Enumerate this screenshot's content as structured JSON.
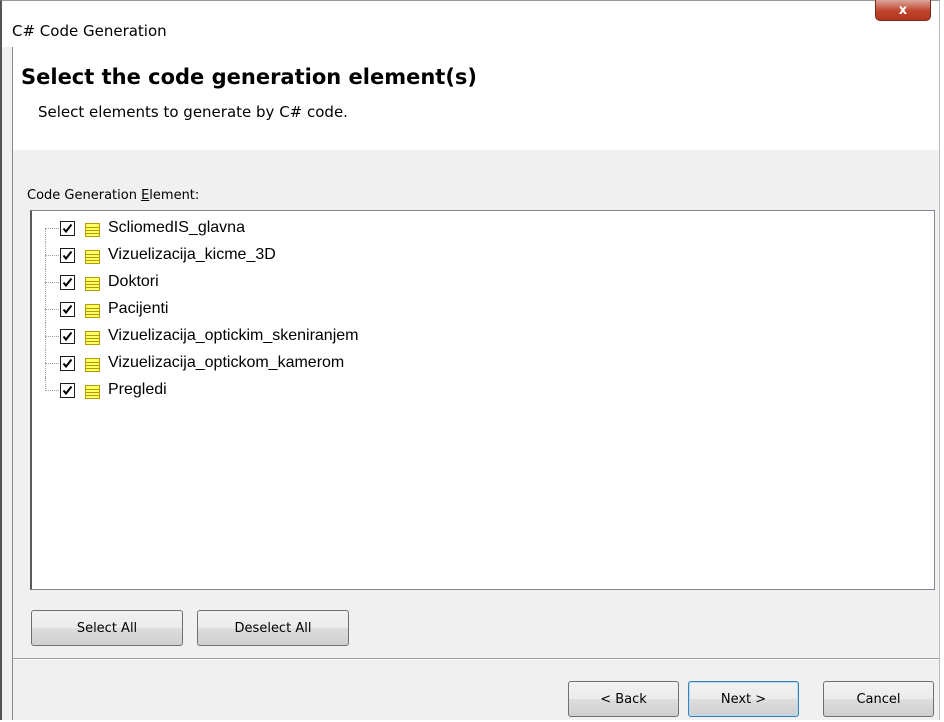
{
  "window": {
    "title": "C# Code Generation",
    "close_label": "x"
  },
  "header": {
    "heading": "Select the code generation element(s)",
    "subheading": "Select elements to generate by C# code."
  },
  "elements": {
    "label_prefix": "Code Generation ",
    "label_mnemonic": "E",
    "label_rest": "lement:",
    "items": [
      {
        "label": "ScliomedIS_glavna",
        "checked": true,
        "icon": "table-icon"
      },
      {
        "label": "Vizuelizacija_kicme_3D",
        "checked": true,
        "icon": "table-icon"
      },
      {
        "label": "Doktori",
        "checked": true,
        "icon": "table-icon"
      },
      {
        "label": "Pacijenti",
        "checked": true,
        "icon": "table-icon"
      },
      {
        "label": "Vizuelizacija_optickim_skeniranjem",
        "checked": true,
        "icon": "table-icon"
      },
      {
        "label": "Vizuelizacija_optickom_kamerom",
        "checked": true,
        "icon": "table-icon"
      },
      {
        "label": "Pregledi",
        "checked": true,
        "icon": "table-icon"
      }
    ]
  },
  "buttons": {
    "select_all": "Select All",
    "deselect_all": "Deselect All",
    "back": "< Back",
    "next": "Next >",
    "cancel": "Cancel"
  },
  "colors": {
    "icon_yellow": "#ffff66",
    "icon_border": "#b59b00",
    "close_red": "#c0442d"
  }
}
